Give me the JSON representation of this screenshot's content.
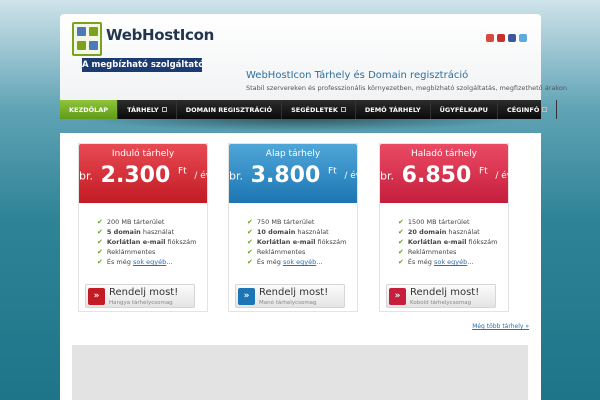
{
  "header": {
    "logo_text": "WebHostIcon",
    "logo_subtitle": "A megbízható szolgáltató",
    "tagline_title": "WebHostIcon Tárhely és Domain regisztráció",
    "tagline_sub": "Stabil szervereken és professzionális környezetben, megbízható szolgáltatás, megfizethető árakon",
    "social_colors": [
      "#d64b3e",
      "#c7302a",
      "#3b5998",
      "#5ea9dd"
    ]
  },
  "nav": {
    "items": [
      {
        "label": "KEZDŐLAP",
        "dropdown": false
      },
      {
        "label": "TÁRHELY",
        "dropdown": true
      },
      {
        "label": "DOMAIN REGISZTRÁCIÓ",
        "dropdown": false
      },
      {
        "label": "SEGÉDLETEK",
        "dropdown": true
      },
      {
        "label": "DEMÓ TÁRHELY",
        "dropdown": false
      },
      {
        "label": "ÜGYFÉLKAPU",
        "dropdown": false
      },
      {
        "label": "CÉGINFÓ",
        "dropdown": true
      }
    ]
  },
  "plans": [
    {
      "title": "Induló tárhely",
      "prefix": "br.",
      "price": "2.300",
      "currency": "Ft",
      "period": "/ év",
      "color": "#d7323b",
      "f1": "200 MB tárterület",
      "f2_b": "5 domain",
      "f2": " használat",
      "f3_b": "Korlátlan e-mail",
      "f3": " fiókszám",
      "f4": "Reklámmentes",
      "f5": "És még ",
      "f5_link": "sok egyéb",
      "f5_end": "...",
      "order_label": "Rendelj most!",
      "order_sub": "Hangya tárhelycsomag"
    },
    {
      "title": "Alap tárhely",
      "prefix": "br.",
      "price": "3.800",
      "currency": "Ft",
      "period": "/ év",
      "color": "#2f8bc6",
      "f1": "750 MB tárterület",
      "f2_b": "10 domain",
      "f2": " használat",
      "f3_b": "Korlátlan e-mail",
      "f3": " fiókszám",
      "f4": "Reklámmentes",
      "f5": "És még ",
      "f5_link": "sok egyéb",
      "f5_end": "...",
      "order_label": "Rendelj most!",
      "order_sub": "Manó tárhelycsomag"
    },
    {
      "title": "Haladó tárhely",
      "prefix": "br.",
      "price": "6.850",
      "currency": "Ft",
      "period": "/ év",
      "color": "#d93552",
      "f1": "1500 MB tárterület",
      "f2_b": "20 domain",
      "f2": " használat",
      "f3_b": "Korlátlan e-mail",
      "f3": " fiókszám",
      "f4": "Reklámmentes",
      "f5": "És még ",
      "f5_link": "sok egyéb",
      "f5_end": "...",
      "order_label": "Rendelj most!",
      "order_sub": "Kobold tárhelycsomag"
    }
  ],
  "more_link": "Még több tárhely »"
}
